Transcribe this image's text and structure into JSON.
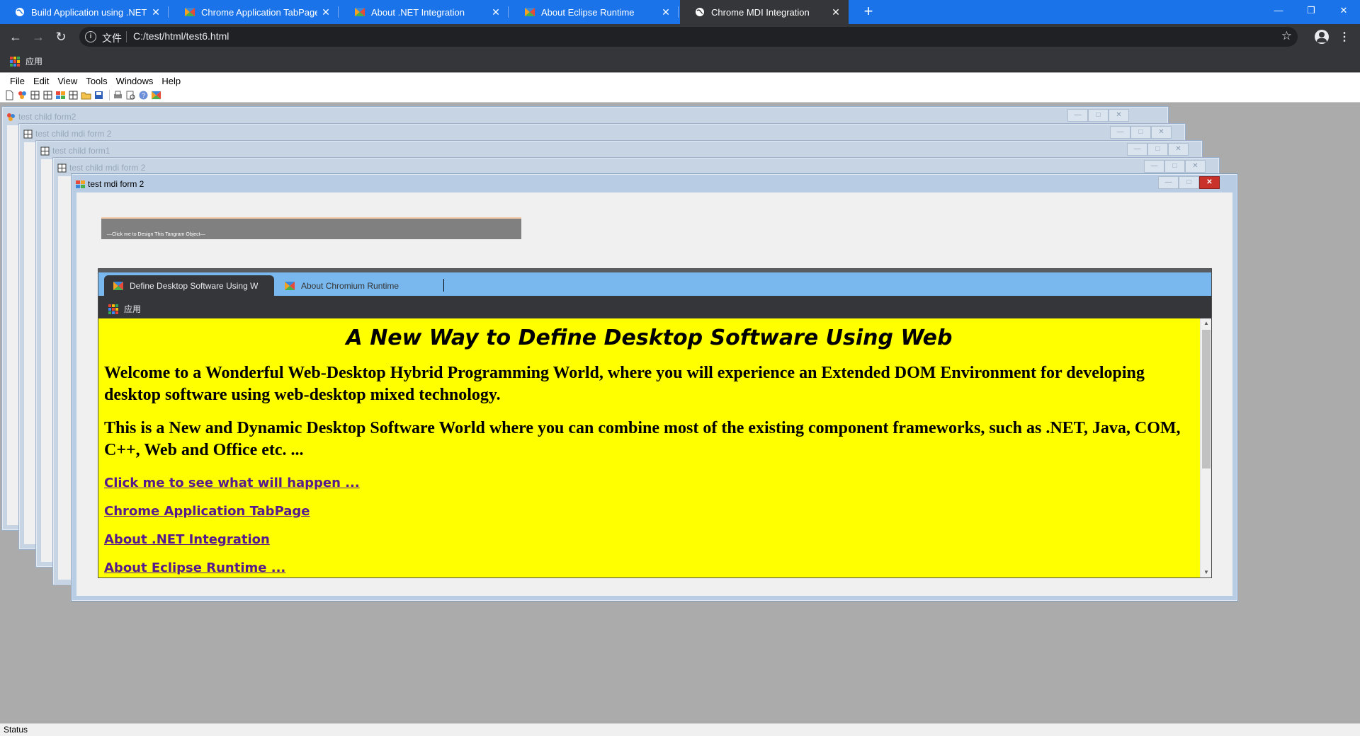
{
  "browser": {
    "tabs": [
      {
        "title": "Build Application using .NET F",
        "icon": "globe-icon"
      },
      {
        "title": "Chrome Application TabPage",
        "icon": "tangram-icon"
      },
      {
        "title": "About .NET Integration",
        "icon": "tangram-icon"
      },
      {
        "title": "About Eclipse Runtime",
        "icon": "tangram-icon"
      },
      {
        "title": "Chrome MDI Integration",
        "icon": "globe-icon"
      }
    ],
    "scheme_label": "文件",
    "url": "C:/test/html/test6.html",
    "bookmarks_apps": "应用"
  },
  "host": {
    "menu": [
      "File",
      "Edit",
      "View",
      "Tools",
      "Windows",
      "Help"
    ],
    "status": "Status"
  },
  "mdi": {
    "children": [
      {
        "title": "test child form2"
      },
      {
        "title": "test child mdi form 2"
      },
      {
        "title": "test child form1"
      },
      {
        "title": "test child mdi form 2"
      }
    ],
    "active": {
      "title": "test mdi form 2",
      "designer_text": "—Click me to Design This Tangram Object—"
    }
  },
  "embedded": {
    "tabs": [
      {
        "title": "Define Desktop Software Using W"
      },
      {
        "title": "About Chromium Runtime"
      }
    ],
    "bookmarks_apps": "应用",
    "heading": "A New Way to Define Desktop Software Using Web",
    "paragraphs": [
      "Welcome to a Wonderful Web-Desktop Hybrid Programming World, where you will experience an Extended DOM Environment for developing desktop software using web-desktop mixed technology.",
      "This is a New and Dynamic Desktop Software World where you can combine most of the existing component frameworks, such as .NET, Java, COM, C++, Web and Office etc. ..."
    ],
    "links": [
      "Click me to see what will happen ...",
      "Chrome Application TabPage",
      "About .NET Integration",
      "About Eclipse Runtime ..."
    ]
  },
  "colors": {
    "tabstrip": "#1a73e8",
    "content_bg": "#ffff00",
    "link": "#551a8b",
    "embedded_tabs": "#79b8ee"
  }
}
